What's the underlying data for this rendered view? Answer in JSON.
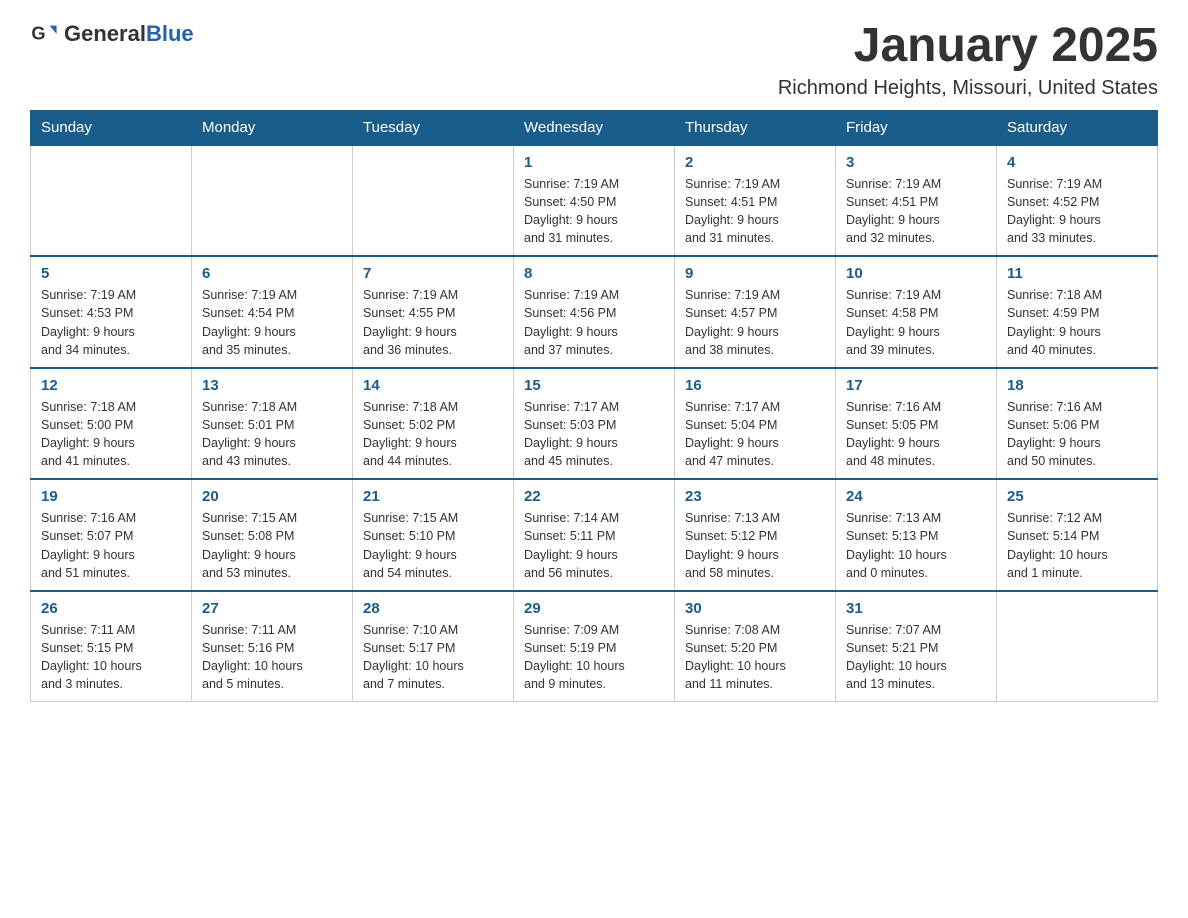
{
  "header": {
    "logo_general": "General",
    "logo_blue": "Blue",
    "month_title": "January 2025",
    "location": "Richmond Heights, Missouri, United States"
  },
  "days_of_week": [
    "Sunday",
    "Monday",
    "Tuesday",
    "Wednesday",
    "Thursday",
    "Friday",
    "Saturday"
  ],
  "weeks": [
    [
      {
        "day": "",
        "info": ""
      },
      {
        "day": "",
        "info": ""
      },
      {
        "day": "",
        "info": ""
      },
      {
        "day": "1",
        "info": "Sunrise: 7:19 AM\nSunset: 4:50 PM\nDaylight: 9 hours\nand 31 minutes."
      },
      {
        "day": "2",
        "info": "Sunrise: 7:19 AM\nSunset: 4:51 PM\nDaylight: 9 hours\nand 31 minutes."
      },
      {
        "day": "3",
        "info": "Sunrise: 7:19 AM\nSunset: 4:51 PM\nDaylight: 9 hours\nand 32 minutes."
      },
      {
        "day": "4",
        "info": "Sunrise: 7:19 AM\nSunset: 4:52 PM\nDaylight: 9 hours\nand 33 minutes."
      }
    ],
    [
      {
        "day": "5",
        "info": "Sunrise: 7:19 AM\nSunset: 4:53 PM\nDaylight: 9 hours\nand 34 minutes."
      },
      {
        "day": "6",
        "info": "Sunrise: 7:19 AM\nSunset: 4:54 PM\nDaylight: 9 hours\nand 35 minutes."
      },
      {
        "day": "7",
        "info": "Sunrise: 7:19 AM\nSunset: 4:55 PM\nDaylight: 9 hours\nand 36 minutes."
      },
      {
        "day": "8",
        "info": "Sunrise: 7:19 AM\nSunset: 4:56 PM\nDaylight: 9 hours\nand 37 minutes."
      },
      {
        "day": "9",
        "info": "Sunrise: 7:19 AM\nSunset: 4:57 PM\nDaylight: 9 hours\nand 38 minutes."
      },
      {
        "day": "10",
        "info": "Sunrise: 7:19 AM\nSunset: 4:58 PM\nDaylight: 9 hours\nand 39 minutes."
      },
      {
        "day": "11",
        "info": "Sunrise: 7:18 AM\nSunset: 4:59 PM\nDaylight: 9 hours\nand 40 minutes."
      }
    ],
    [
      {
        "day": "12",
        "info": "Sunrise: 7:18 AM\nSunset: 5:00 PM\nDaylight: 9 hours\nand 41 minutes."
      },
      {
        "day": "13",
        "info": "Sunrise: 7:18 AM\nSunset: 5:01 PM\nDaylight: 9 hours\nand 43 minutes."
      },
      {
        "day": "14",
        "info": "Sunrise: 7:18 AM\nSunset: 5:02 PM\nDaylight: 9 hours\nand 44 minutes."
      },
      {
        "day": "15",
        "info": "Sunrise: 7:17 AM\nSunset: 5:03 PM\nDaylight: 9 hours\nand 45 minutes."
      },
      {
        "day": "16",
        "info": "Sunrise: 7:17 AM\nSunset: 5:04 PM\nDaylight: 9 hours\nand 47 minutes."
      },
      {
        "day": "17",
        "info": "Sunrise: 7:16 AM\nSunset: 5:05 PM\nDaylight: 9 hours\nand 48 minutes."
      },
      {
        "day": "18",
        "info": "Sunrise: 7:16 AM\nSunset: 5:06 PM\nDaylight: 9 hours\nand 50 minutes."
      }
    ],
    [
      {
        "day": "19",
        "info": "Sunrise: 7:16 AM\nSunset: 5:07 PM\nDaylight: 9 hours\nand 51 minutes."
      },
      {
        "day": "20",
        "info": "Sunrise: 7:15 AM\nSunset: 5:08 PM\nDaylight: 9 hours\nand 53 minutes."
      },
      {
        "day": "21",
        "info": "Sunrise: 7:15 AM\nSunset: 5:10 PM\nDaylight: 9 hours\nand 54 minutes."
      },
      {
        "day": "22",
        "info": "Sunrise: 7:14 AM\nSunset: 5:11 PM\nDaylight: 9 hours\nand 56 minutes."
      },
      {
        "day": "23",
        "info": "Sunrise: 7:13 AM\nSunset: 5:12 PM\nDaylight: 9 hours\nand 58 minutes."
      },
      {
        "day": "24",
        "info": "Sunrise: 7:13 AM\nSunset: 5:13 PM\nDaylight: 10 hours\nand 0 minutes."
      },
      {
        "day": "25",
        "info": "Sunrise: 7:12 AM\nSunset: 5:14 PM\nDaylight: 10 hours\nand 1 minute."
      }
    ],
    [
      {
        "day": "26",
        "info": "Sunrise: 7:11 AM\nSunset: 5:15 PM\nDaylight: 10 hours\nand 3 minutes."
      },
      {
        "day": "27",
        "info": "Sunrise: 7:11 AM\nSunset: 5:16 PM\nDaylight: 10 hours\nand 5 minutes."
      },
      {
        "day": "28",
        "info": "Sunrise: 7:10 AM\nSunset: 5:17 PM\nDaylight: 10 hours\nand 7 minutes."
      },
      {
        "day": "29",
        "info": "Sunrise: 7:09 AM\nSunset: 5:19 PM\nDaylight: 10 hours\nand 9 minutes."
      },
      {
        "day": "30",
        "info": "Sunrise: 7:08 AM\nSunset: 5:20 PM\nDaylight: 10 hours\nand 11 minutes."
      },
      {
        "day": "31",
        "info": "Sunrise: 7:07 AM\nSunset: 5:21 PM\nDaylight: 10 hours\nand 13 minutes."
      },
      {
        "day": "",
        "info": ""
      }
    ]
  ]
}
